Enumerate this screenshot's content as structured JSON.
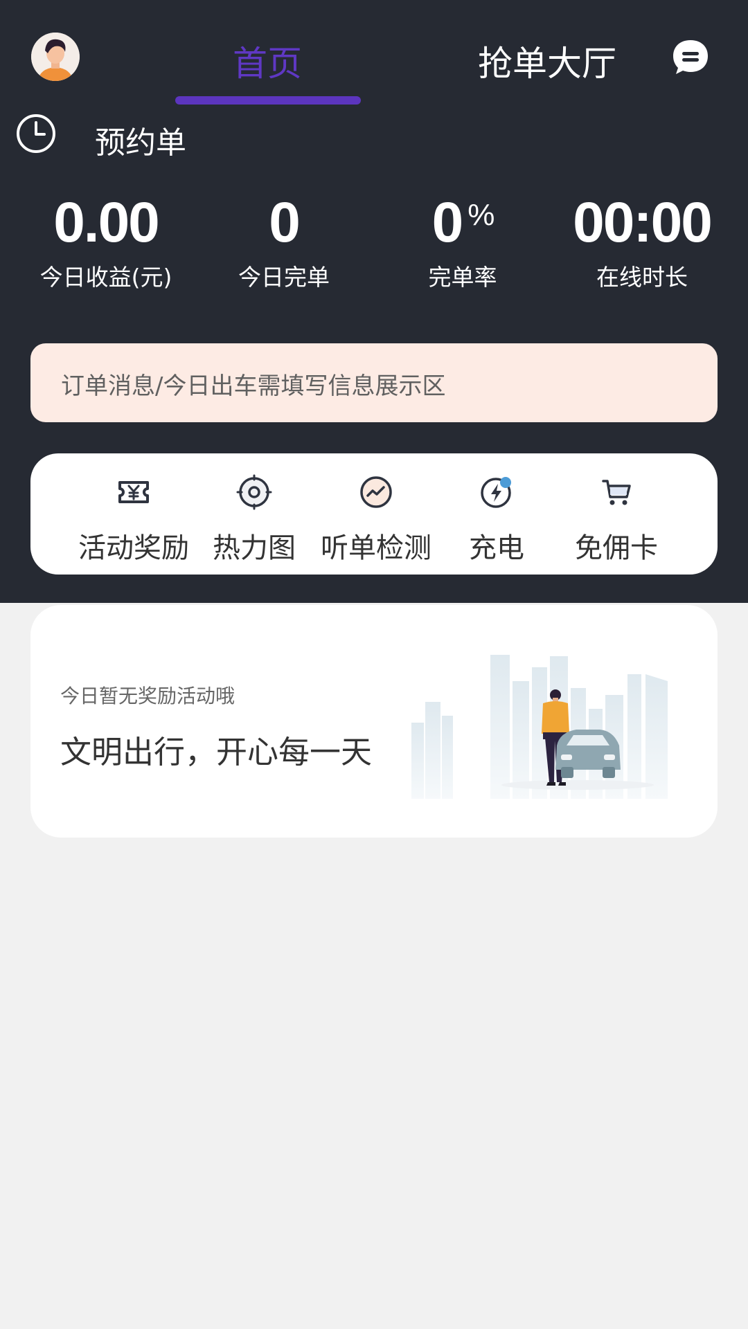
{
  "header": {
    "avatar_icon": "driver-avatar-icon",
    "tabs": [
      {
        "label": "首页",
        "active": true
      },
      {
        "label": "抢单大厅",
        "active": false
      }
    ],
    "message_icon": "chat-bubble-icon",
    "accent_color": "#5c35bf"
  },
  "reservation": {
    "icon": "clock-icon",
    "label": "预约单"
  },
  "stats": [
    {
      "value": "0.00",
      "unit": "",
      "label": "今日收益(元)"
    },
    {
      "value": "0",
      "unit": "",
      "label": "今日完单"
    },
    {
      "value": "0",
      "unit": "%",
      "label": "完单率"
    },
    {
      "value": "00:00",
      "unit": "",
      "label": "在线时长"
    }
  ],
  "notice": {
    "text": "订单消息/今日出车需填写信息展示区"
  },
  "toolbar": {
    "items": [
      {
        "label": "活动奖励",
        "icon": "coupon-yen-icon"
      },
      {
        "label": "热力图",
        "icon": "target-icon"
      },
      {
        "label": "听单检测",
        "icon": "trend-circle-icon"
      },
      {
        "label": "充电",
        "icon": "charge-bolt-icon"
      },
      {
        "label": "免佣卡",
        "icon": "cart-icon"
      }
    ]
  },
  "promo": {
    "subtitle": "今日暂无奖励活动哦",
    "title": "文明出行，开心每一天",
    "illustration": "city-driver-car-illustration"
  }
}
